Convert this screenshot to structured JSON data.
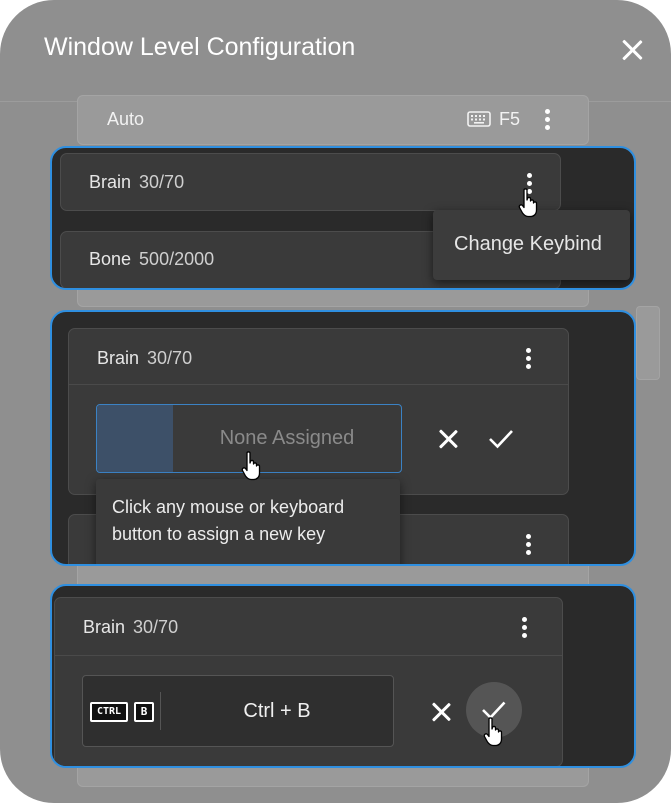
{
  "dialog": {
    "title": "Window Level Configuration",
    "close_icon": "close-icon"
  },
  "background_item": {
    "label": "Auto",
    "keybind": "F5",
    "keyboard_icon": "keyboard-icon"
  },
  "step1": {
    "cards": [
      {
        "name": "Brain",
        "value": "30/70"
      },
      {
        "name": "Bone",
        "value": "500/2000"
      }
    ],
    "menu_item": "Change Keybind"
  },
  "step2": {
    "card": {
      "name": "Brain",
      "value": "30/70"
    },
    "input_placeholder": "None Assigned",
    "tooltip_line1": "Click any mouse or keyboard",
    "tooltip_line2": "button to assign a new key"
  },
  "step3": {
    "card": {
      "name": "Brain",
      "value": "30/70"
    },
    "key_ctrl_badge": "CTRL",
    "key_b_badge": "B",
    "key_value": "Ctrl + B"
  },
  "colors": {
    "highlight_border": "#2f8fe0",
    "panel": "#8f8f8f",
    "dark_surface": "#2a2a2a"
  }
}
